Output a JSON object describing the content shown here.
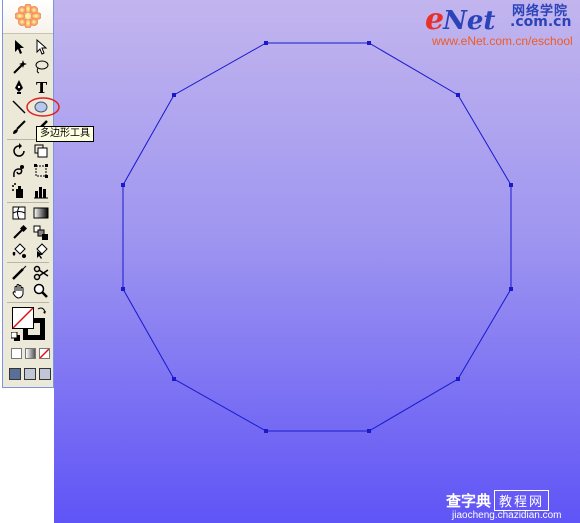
{
  "app": {
    "title": "Adobe Illustrator"
  },
  "toolbox": {
    "tools": [
      {
        "name": "selection-tool",
        "icon": "arrow-icon"
      },
      {
        "name": "direct-selection-tool",
        "icon": "white-arrow-icon"
      },
      {
        "name": "magic-wand-tool",
        "icon": "magic-wand-icon"
      },
      {
        "name": "lasso-tool",
        "icon": "lasso-icon"
      },
      {
        "name": "pen-tool",
        "icon": "pen-icon"
      },
      {
        "name": "type-tool",
        "icon": "type-icon"
      },
      {
        "name": "line-segment-tool",
        "icon": "line-icon"
      },
      {
        "name": "polygon-tool",
        "icon": "polygon-icon",
        "selected": true
      },
      {
        "name": "paintbrush-tool",
        "icon": "brush-icon"
      },
      {
        "name": "pencil-tool",
        "icon": "pencil-icon"
      },
      {
        "name": "rotate-tool",
        "icon": "rotate-icon"
      },
      {
        "name": "scale-tool",
        "icon": "scale-icon"
      },
      {
        "name": "warp-tool",
        "icon": "warp-icon"
      },
      {
        "name": "free-transform-tool",
        "icon": "free-transform-icon"
      },
      {
        "name": "symbol-sprayer-tool",
        "icon": "symbol-sprayer-icon"
      },
      {
        "name": "column-graph-tool",
        "icon": "graph-icon"
      },
      {
        "name": "mesh-tool",
        "icon": "mesh-icon"
      },
      {
        "name": "gradient-tool",
        "icon": "gradient-icon"
      },
      {
        "name": "eyedropper-tool",
        "icon": "eyedropper-icon"
      },
      {
        "name": "blend-tool",
        "icon": "blend-icon"
      },
      {
        "name": "live-paint-bucket-tool",
        "icon": "paint-bucket-icon"
      },
      {
        "name": "live-paint-selection-tool",
        "icon": "paint-selection-icon"
      },
      {
        "name": "slice-tool",
        "icon": "slice-icon"
      },
      {
        "name": "scissors-tool",
        "icon": "scissors-icon"
      },
      {
        "name": "hand-tool",
        "icon": "hand-icon"
      },
      {
        "name": "zoom-tool",
        "icon": "zoom-icon"
      }
    ],
    "tooltip": "多边形工具",
    "fill_stroke": {
      "fill": "none",
      "stroke": "#000000"
    },
    "color_modes": [
      "color",
      "gradient",
      "none"
    ],
    "screen_modes": [
      "standard-screen-mode",
      "full-screen-mode-with-menu",
      "full-screen-mode"
    ]
  },
  "canvas": {
    "shape": "dodecagon",
    "stroke_color": "#1a1acc",
    "background_top": "#c2b5ee",
    "background_bottom": "#5f54f6"
  },
  "watermark": {
    "logo_e": "e",
    "logo_net": "Net",
    "chinese": "网络学院",
    "domain": ".com.cn",
    "url": "www.eNet.com.cn/eschool"
  },
  "bottom_brand": {
    "text": "查字典",
    "boxed": "教程网",
    "url": "jiaocheng.chazidian.com"
  }
}
